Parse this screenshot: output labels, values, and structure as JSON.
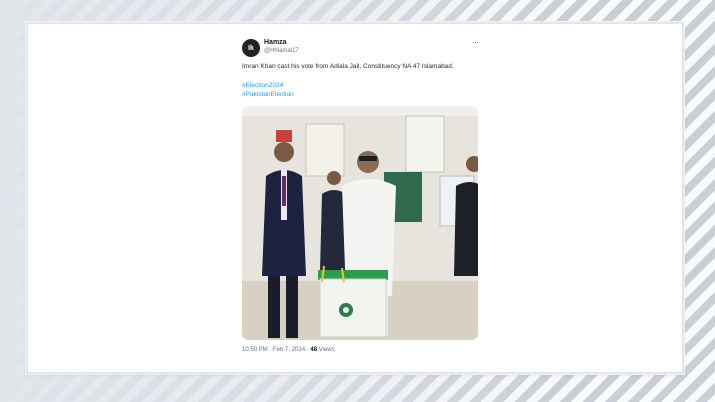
{
  "tweet": {
    "display_name": "Hamza",
    "handle": "@Hhlamal17",
    "avatar_initials": "Ik",
    "text": "Imran Khan cast his vote from Adiala Jail, Constituency NA 47 Islamabad.",
    "hashtags": [
      "#Election2024",
      "#PakistanElection"
    ],
    "time": "10:50 PM · Feb 7, 2024 · ",
    "views_count": "48",
    "views_label": " Views"
  },
  "photo": {
    "ballot_box_color": "#2e9c4c",
    "wall_color": "#e7e4dd"
  },
  "colors": {
    "link": "#1d9bf0",
    "background": "#d9dde2"
  }
}
